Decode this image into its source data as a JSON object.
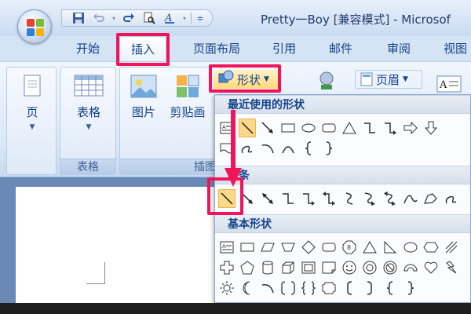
{
  "window": {
    "title": "Pretty一Boy [兼容模式] - Microsof"
  },
  "tabs": [
    {
      "label": "开始"
    },
    {
      "label": "插入"
    },
    {
      "label": "页面布局"
    },
    {
      "label": "引用"
    },
    {
      "label": "邮件"
    },
    {
      "label": "审阅"
    },
    {
      "label": "视图"
    }
  ],
  "active_tab": "插入",
  "ribbon": {
    "page_button": "页",
    "table_button": "表格",
    "table_group": "表格",
    "picture_button": "图片",
    "clipart_button": "剪贴画",
    "illustrations_group_partial": "插图",
    "shapes_button": "形状",
    "header_button": "页眉"
  },
  "shapes_menu": {
    "recent_heading": "最近使用的形状",
    "lines_heading": "线条",
    "basic_heading": "基本形状"
  },
  "colors": {
    "highlight_callout": "#f0145a",
    "selected_shape": "#fcd989",
    "ribbon_text": "#15428b"
  }
}
